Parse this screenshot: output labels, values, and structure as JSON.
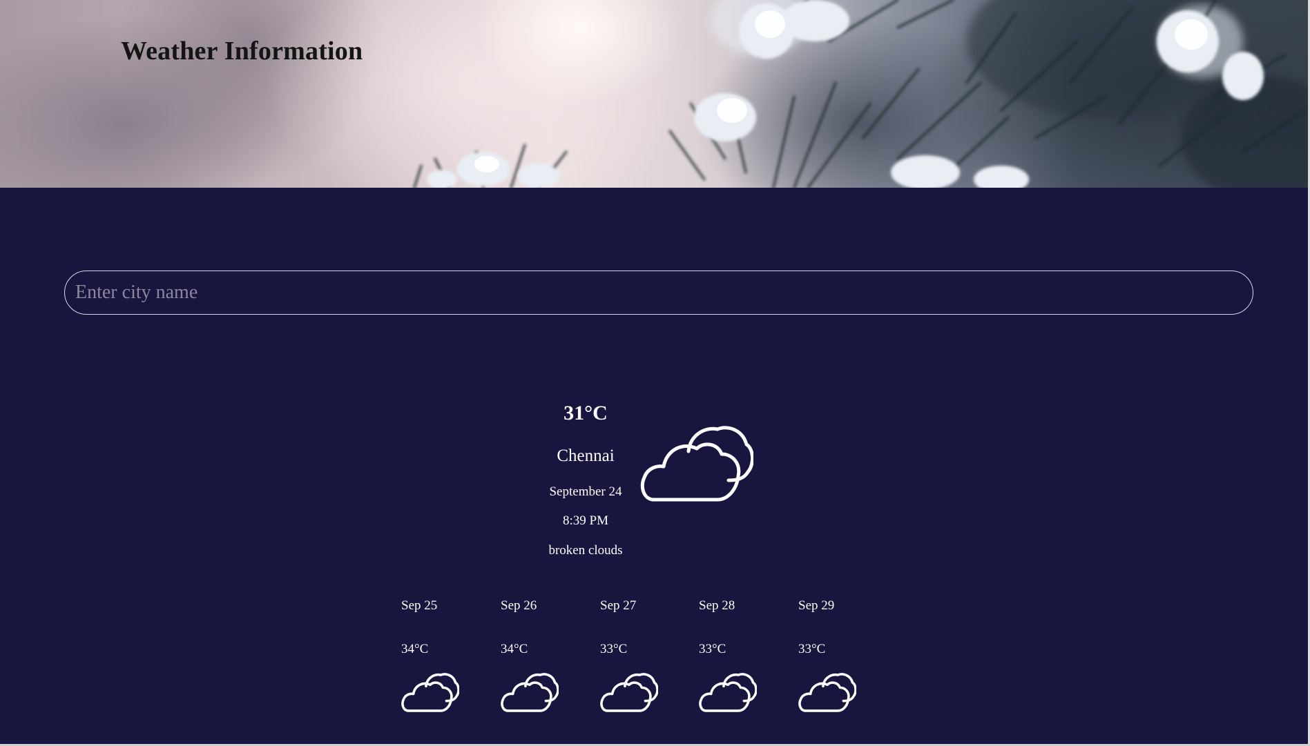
{
  "header": {
    "title": "Weather Information"
  },
  "search": {
    "placeholder": "Enter city name",
    "value": ""
  },
  "current": {
    "temperature": "31°C",
    "city": "Chennai",
    "date": "September 24",
    "time": "8:39 PM",
    "description": "broken clouds",
    "icon": "broken-clouds-icon"
  },
  "forecast": [
    {
      "date": "Sep 25",
      "temperature": "34°C",
      "icon": "broken-clouds-icon"
    },
    {
      "date": "Sep 26",
      "temperature": "34°C",
      "icon": "broken-clouds-icon"
    },
    {
      "date": "Sep 27",
      "temperature": "33°C",
      "icon": "broken-clouds-icon"
    },
    {
      "date": "Sep 28",
      "temperature": "33°C",
      "icon": "broken-clouds-icon"
    },
    {
      "date": "Sep 29",
      "temperature": "33°C",
      "icon": "broken-clouds-icon"
    }
  ],
  "colors": {
    "background": "#18153f",
    "text": "#ffffff",
    "title": "#141414",
    "input_border": "#d9d9e4"
  }
}
